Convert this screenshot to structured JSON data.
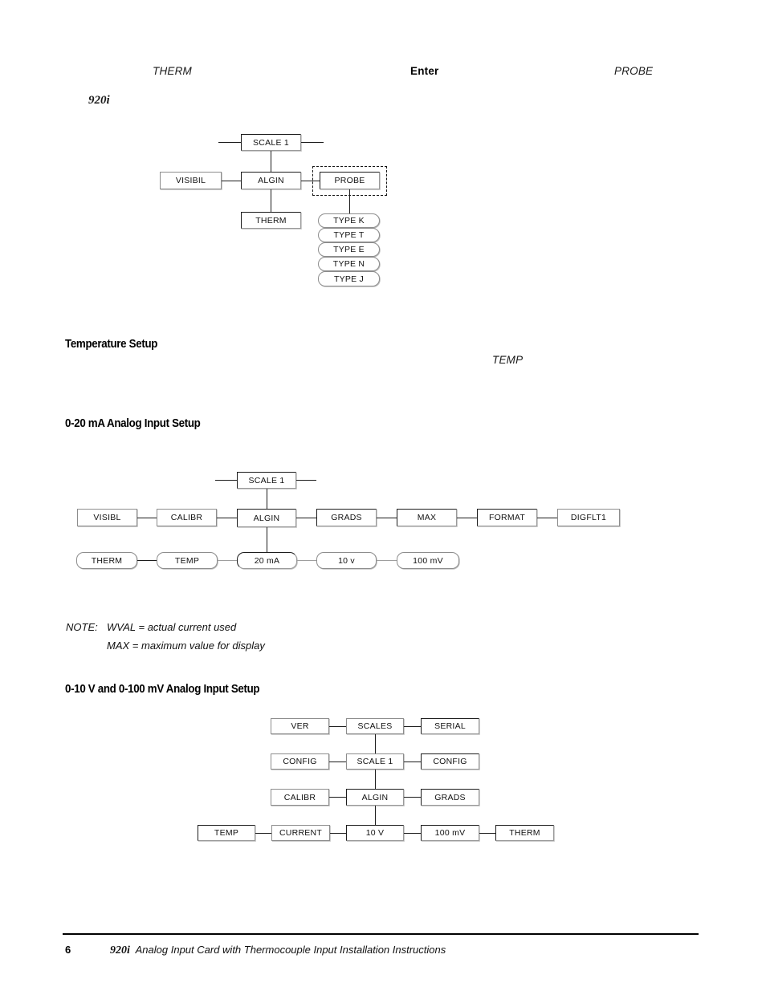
{
  "page": {
    "number": "6",
    "footer_title_prefix": "920i",
    "footer_title": "Analog Input Card with Thermocouple Input Installation Instructions"
  },
  "top_fragments": {
    "therm": "THERM",
    "enter": "Enter",
    "probe": "PROBE",
    "model": "920i"
  },
  "sections": [
    {
      "heading": "Temperature Setup",
      "fragment": "TEMP"
    },
    {
      "heading": "0-20 mA Analog Input Setup"
    },
    {
      "heading": "0-10 V and 0-100 mV Analog Input Setup"
    }
  ],
  "note": {
    "label": "NOTE:",
    "lines": [
      "WVAL = actual current used",
      "MAX = maximum value for display"
    ]
  },
  "diagram1": {
    "scale1": "SCALE 1",
    "visibil": "VISIBIL",
    "algin": "ALGIN",
    "probe": "PROBE",
    "therm": "THERM",
    "types": [
      "TYPE K",
      "TYPE T",
      "TYPE E",
      "TYPE N",
      "TYPE J"
    ]
  },
  "diagram2": {
    "row_top": [
      "SCALE 1"
    ],
    "row_mid": [
      "VISIBL",
      "CALIBR",
      "ALGIN",
      "GRADS",
      "MAX",
      "FORMAT",
      "DIGFLT1"
    ],
    "row_bot": [
      "THERM",
      "TEMP",
      "20 mA",
      "10 v",
      "100 mV"
    ]
  },
  "diagram3": {
    "row1": [
      "VER",
      "SCALES",
      "SERIAL"
    ],
    "row2": [
      "CONFIG",
      "SCALE 1",
      "CONFIG"
    ],
    "row3": [
      "CALIBR",
      "ALGIN",
      "GRADS"
    ],
    "row4": [
      "TEMP",
      "CURRENT",
      "10 V",
      "100 mV",
      "THERM"
    ]
  }
}
